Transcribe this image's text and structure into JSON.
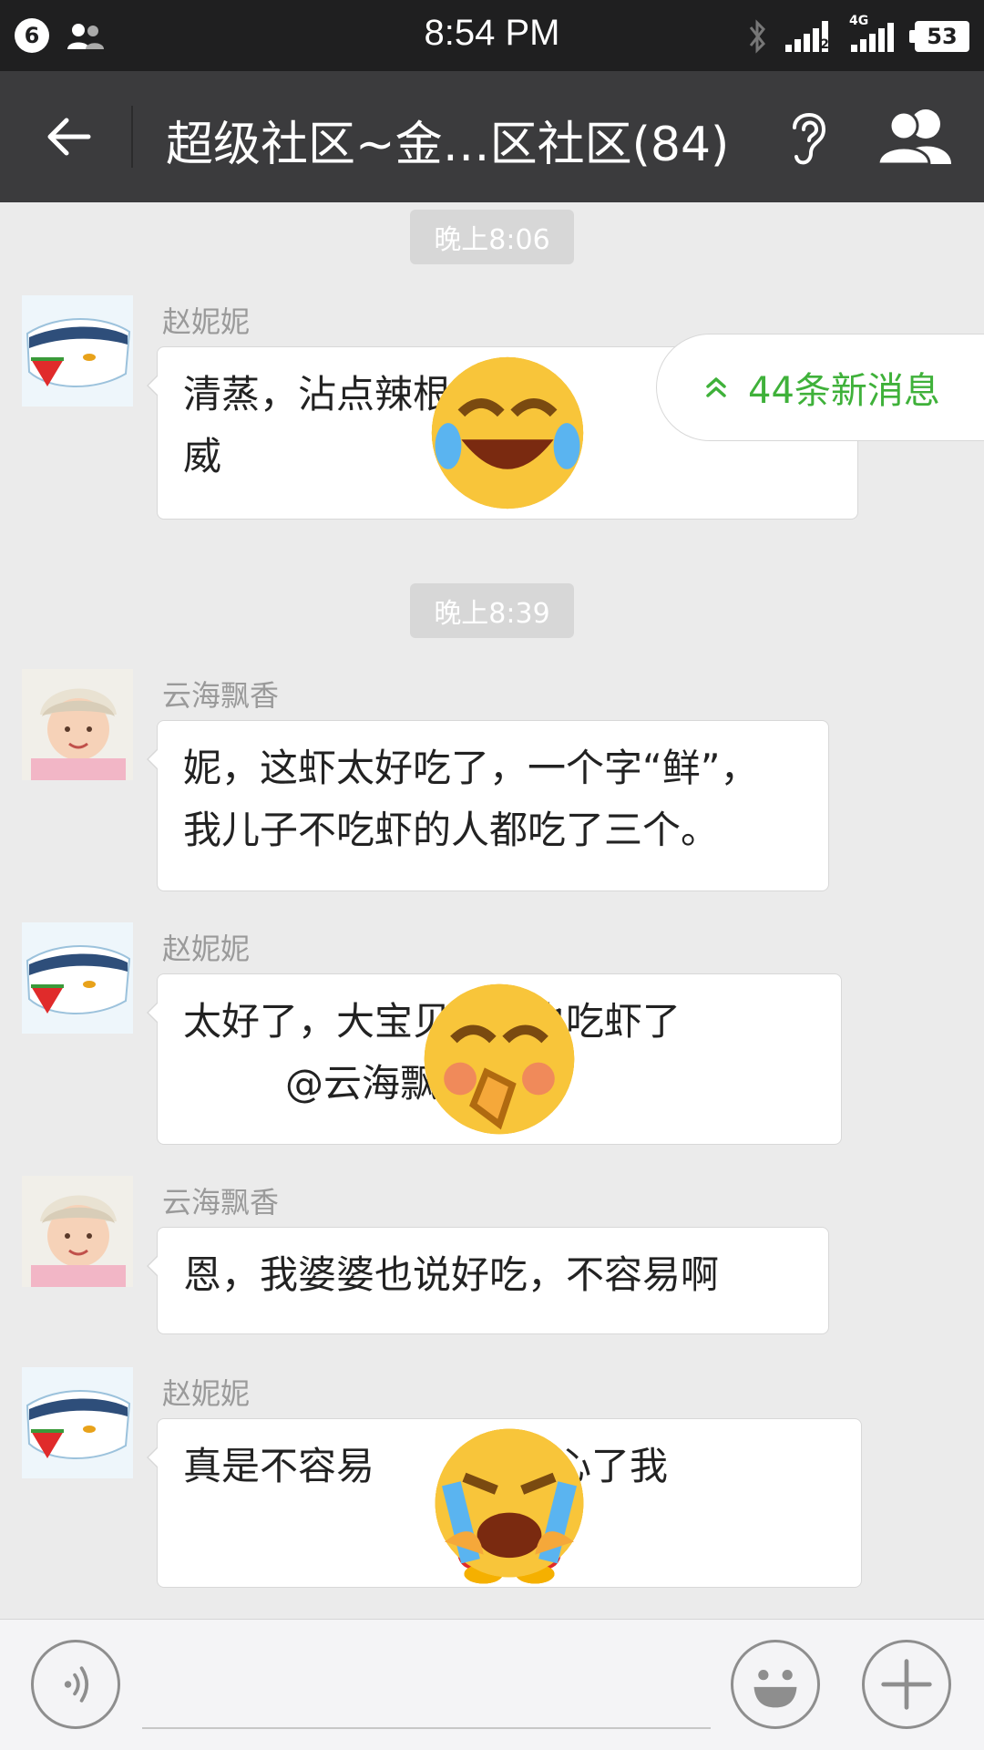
{
  "status_bar": {
    "notification_count": "6",
    "time": "8:54 PM",
    "network_tag": "4G",
    "sim_tag": "2",
    "battery": "53"
  },
  "title_bar": {
    "title": "超级社区~金…区社区(84)"
  },
  "chat": {
    "time_dividers": [
      "晚上8:06",
      "晚上8:39"
    ],
    "new_messages_label": "44条新消息",
    "messages": [
      {
        "sender": "赵妮妮",
        "line1_text": "清蒸，沾点辣根",
        "line1_emojis": [
          "laugh-cry",
          "laugh-cry",
          "laugh-cry"
        ],
        "line2_text": "威"
      },
      {
        "sender": "云海飘香",
        "line1_text": "妮，这虾太好吃了，一个字“鲜”，",
        "line2_text": "我儿子不吃虾的人都吃了三个。"
      },
      {
        "sender": "赵妮妮",
        "line1_text": "太好了，大宝贝儿子也吃虾了",
        "line1_emojis": [
          "giggle"
        ],
        "line2_emojis": [
          "giggle",
          "giggle"
        ],
        "line2_text": "@云海飘香"
      },
      {
        "sender": "云海飘香",
        "line1_text": "恩，我婆婆也说好吃，不容易啊"
      },
      {
        "sender": "赵妮妮",
        "line1_text_a": "真是不容易",
        "line1_emojis_a": [
          "laugh-cry",
          "laugh-cry"
        ],
        "line1_text_b": "太开心了我",
        "line1_emojis_b": [
          "penguin",
          "penguin"
        ],
        "line2_emojis": [
          "penguin",
          "sob",
          "sob"
        ]
      }
    ]
  },
  "colors": {
    "status_bg": "#1f1f20",
    "title_bg": "#3b3b3d",
    "chat_bg": "#ebebeb",
    "accent_green": "#3fb13a"
  },
  "icons": [
    "back-arrow-icon",
    "ear-icon",
    "group-members-icon",
    "voice-input-icon",
    "emoji-icon",
    "plus-icon",
    "chevron-up-icon"
  ]
}
